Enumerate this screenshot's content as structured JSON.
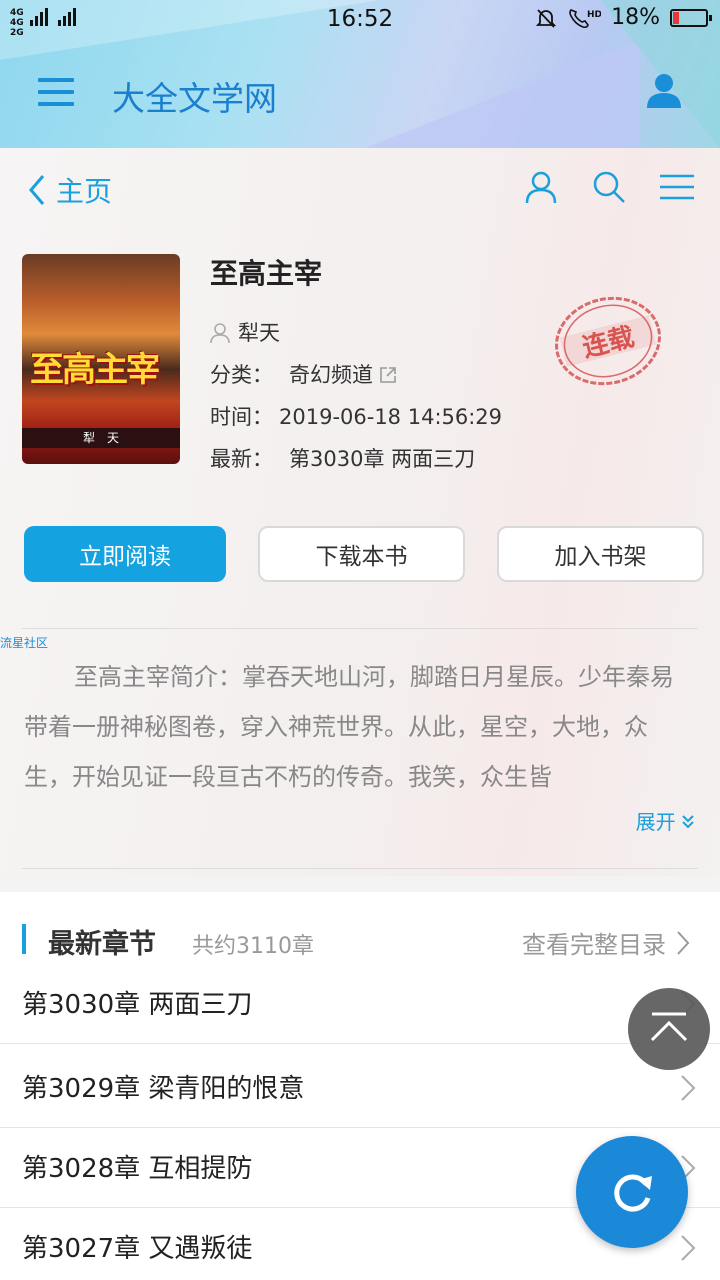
{
  "status_bar": {
    "network_label": "4G 4G 2G",
    "time": "16:52",
    "battery": "18%",
    "battery_level": 0.18
  },
  "header": {
    "site_title": "大全文学网"
  },
  "subnav": {
    "back_label": "主页"
  },
  "book": {
    "title": "至高主宰",
    "author": "犁天",
    "category_label": "分类：",
    "category": "奇幻频道",
    "time_label": "时间：",
    "time": "2019-06-18 14:56:29",
    "latest_label": "最新：",
    "latest": "第3030章 两面三刀",
    "status_stamp": "连载",
    "cover_title": "至高主宰",
    "cover_author": "犁　天"
  },
  "actions": {
    "read": "立即阅读",
    "download": "下载本书",
    "add_shelf": "加入书架"
  },
  "ad_tag": "流星社区",
  "intro": {
    "text": "至高主宰简介：掌吞天地山河，脚踏日月星辰。少年秦易带着一册神秘图卷，穿入神荒世界。从此，星空，大地，众生，开始见证一段亘古不朽的传奇。我笑，众生皆",
    "expand": "展开"
  },
  "chapters": {
    "heading": "最新章节",
    "count": "共约3110章",
    "view_all": "查看完整目录",
    "items": [
      {
        "title": "第3030章 两面三刀"
      },
      {
        "title": "第3029章 梁青阳的恨意"
      },
      {
        "title": "第3028章 互相提防"
      },
      {
        "title": "第3027章 又遇叛徒"
      }
    ]
  },
  "colors": {
    "accent": "#14a2e0",
    "title_blue": "#1a7fcf",
    "fab_blue": "#1c88d8",
    "stamp_red": "#d9534f"
  }
}
